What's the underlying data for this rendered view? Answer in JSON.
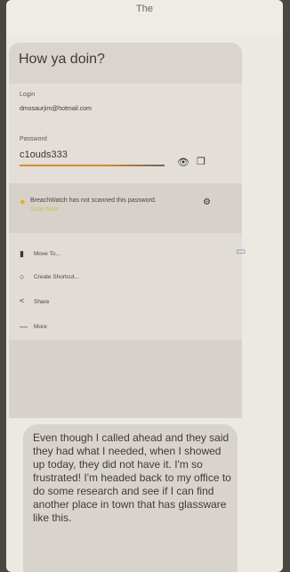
{
  "header": {
    "title": "The"
  },
  "messages": {
    "greeting": "How ya doin?",
    "body": "Even though I called ahead and they said they had what I needed, when I showed up today, they did not have it. I'm so frustrated! I'm headed back to my office to do some research and see if I can find another place in town that has glassware like this."
  },
  "credential": {
    "login_label": "Login",
    "login_value": "dmosaurjim@hotmail.com",
    "password_label": "Password",
    "password_value": "c1ouds333",
    "toggle_visibility_icon": "eye-off-icon",
    "copy_icon": "copy-icon"
  },
  "breachwatch": {
    "text": "BreachWatch has not scanned this password.",
    "link": "Scan Now",
    "status_icon": "warning-icon",
    "settings_icon": "gear-icon"
  },
  "menu": {
    "items": [
      {
        "label": "Move To...",
        "icon": "folder-icon"
      },
      {
        "label": "Create Shortcut...",
        "icon": "link-icon"
      },
      {
        "label": "Share",
        "icon": "share-icon"
      },
      {
        "label": "More",
        "icon": "more-icon"
      }
    ]
  },
  "side": {
    "icon": "export-icon"
  },
  "colors": {
    "accent": "#d88a2c",
    "warning": "#e0b020",
    "side_icon": "#7b8fb6"
  }
}
